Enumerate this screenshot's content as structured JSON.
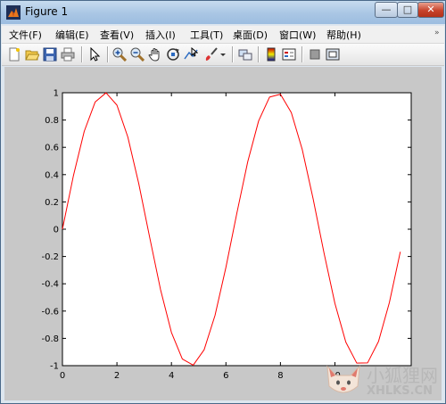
{
  "window": {
    "title": "Figure 1"
  },
  "title_buttons": {
    "minimize": "—",
    "maximize": "□",
    "close": "✕"
  },
  "menu": {
    "items": [
      {
        "label": "文件(F)"
      },
      {
        "label": "编辑(E)"
      },
      {
        "label": "查看(V)"
      },
      {
        "label": "插入(I)"
      },
      {
        "label": "工具(T)"
      },
      {
        "label": "桌面(D)"
      },
      {
        "label": "窗口(W)"
      },
      {
        "label": "帮助(H)"
      }
    ],
    "overflow": "»"
  },
  "toolbar": {
    "icons": [
      "new-figure-icon",
      "open-file-icon",
      "save-icon",
      "print-icon",
      "pointer-icon",
      "zoom-in-icon",
      "zoom-out-icon",
      "pan-hand-icon",
      "rotate-3d-icon",
      "data-cursor-icon",
      "brush-icon",
      "dropdown-arrow-icon",
      "link-plot-icon",
      "colorbar-icon",
      "legend-icon",
      "hide-plot-tools-icon",
      "show-plot-tools-icon"
    ]
  },
  "chart_data": {
    "type": "line",
    "title": "",
    "xlabel": "",
    "ylabel": "",
    "xlim": [
      0,
      12.8
    ],
    "ylim": [
      -1,
      1
    ],
    "xticks": [
      "0",
      "2",
      "4",
      "6",
      "8",
      "10"
    ],
    "yticks": [
      "1",
      "0.8",
      "0.6",
      "0.4",
      "0.2",
      "0",
      "-0.2",
      "-0.4",
      "-0.6",
      "-0.8",
      "-1"
    ],
    "series": [
      {
        "color": "#ff0000",
        "x": [
          0,
          0.4,
          0.8,
          1.2,
          1.6,
          2.0,
          2.4,
          2.8,
          3.2,
          3.6,
          4.0,
          4.4,
          4.8,
          5.2,
          5.6,
          6.0,
          6.4,
          6.8,
          7.2,
          7.6,
          8.0,
          8.4,
          8.8,
          9.2,
          9.6,
          10.0,
          10.4,
          10.8,
          11.2,
          11.6,
          12.0,
          12.4
        ],
        "y": [
          0,
          0.3894,
          0.7174,
          0.932,
          0.9996,
          0.9093,
          0.6755,
          0.335,
          -0.0584,
          -0.4425,
          -0.7568,
          -0.9516,
          -0.9962,
          -0.8835,
          -0.6313,
          -0.2794,
          0.1165,
          0.4941,
          0.7937,
          0.9679,
          0.9894,
          0.8546,
          0.5849,
          0.2229,
          -0.1743,
          -0.544,
          -0.8278,
          -0.9809,
          -0.9792,
          -0.8228,
          -0.5366,
          -0.1654
        ]
      }
    ],
    "grid": false
  },
  "watermark": {
    "line1": "小狐狸网",
    "line2": "XHLKS.CN"
  }
}
